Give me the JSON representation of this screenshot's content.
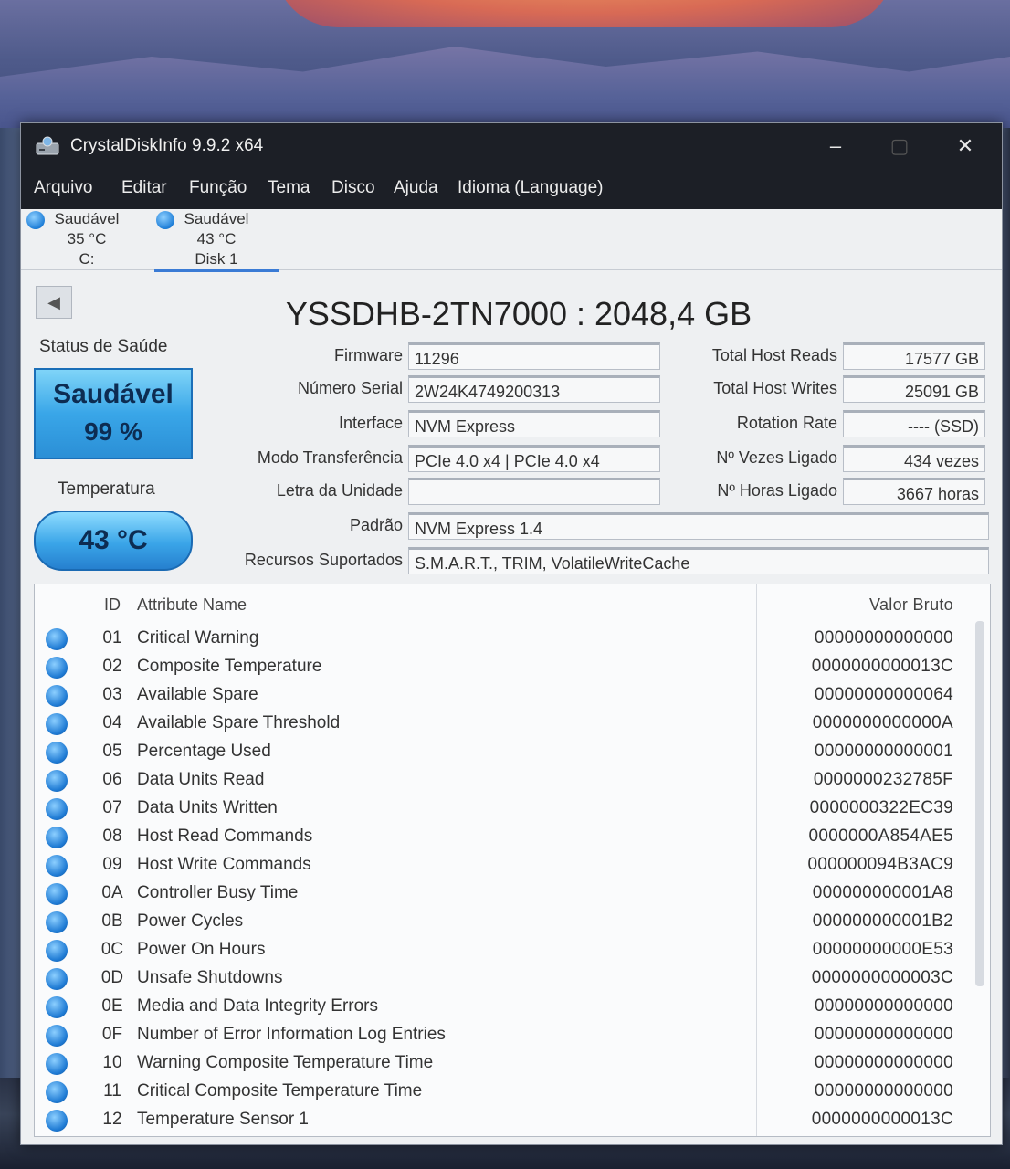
{
  "window": {
    "title": "CrystalDiskInfo 9.9.2 x64",
    "minimize_glyph": "–",
    "maximize_glyph": "▢",
    "close_glyph": "✕"
  },
  "menu": [
    "Arquivo",
    "Editar",
    "Função",
    "Tema",
    "Disco",
    "Ajuda",
    "Idioma (Language)"
  ],
  "drives": [
    {
      "status": "Saudável",
      "temp": "35 °C",
      "name": "C:"
    },
    {
      "status": "Saudável",
      "temp": "43 °C",
      "name": "Disk 1"
    }
  ],
  "health": {
    "label": "Status de Saúde",
    "status": "Saudável",
    "percent": "99 %",
    "temp_label": "Temperatura",
    "temp_value": "43 °C",
    "color": "#39a6e8"
  },
  "model": "YSSDHB-2TN7000 : 2048,4 GB",
  "info": {
    "firmware": {
      "label": "Firmware",
      "value": "11296"
    },
    "serial": {
      "label": "Número Serial",
      "value": "2W24K4749200313"
    },
    "interface": {
      "label": "Interface",
      "value": "NVM Express"
    },
    "transfer": {
      "label": "Modo Transferência",
      "value": "PCIe 4.0 x4 | PCIe 4.0 x4"
    },
    "drive_letter": {
      "label": "Letra da Unidade",
      "value": ""
    },
    "standard": {
      "label": "Padrão",
      "value": "NVM Express 1.4"
    },
    "features": {
      "label": "Recursos Suportados",
      "value": "S.M.A.R.T., TRIM, VolatileWriteCache"
    },
    "host_reads": {
      "label": "Total Host Reads",
      "value": "17577 GB"
    },
    "host_writes": {
      "label": "Total Host Writes",
      "value": "25091 GB"
    },
    "rotation": {
      "label": "Rotation Rate",
      "value": "---- (SSD)"
    },
    "power_count": {
      "label": "Nº Vezes Ligado",
      "value": "434 vezes"
    },
    "power_hours": {
      "label": "Nº Horas Ligado",
      "value": "3667 horas"
    }
  },
  "smart": {
    "headers": {
      "id": "ID",
      "name": "Attribute Name",
      "raw": "Valor Bruto"
    },
    "rows": [
      {
        "id": "01",
        "name": "Critical Warning",
        "raw": "00000000000000"
      },
      {
        "id": "02",
        "name": "Composite Temperature",
        "raw": "0000000000013C"
      },
      {
        "id": "03",
        "name": "Available Spare",
        "raw": "00000000000064"
      },
      {
        "id": "04",
        "name": "Available Spare Threshold",
        "raw": "0000000000000A"
      },
      {
        "id": "05",
        "name": "Percentage Used",
        "raw": "00000000000001"
      },
      {
        "id": "06",
        "name": "Data Units Read",
        "raw": "0000000232785F"
      },
      {
        "id": "07",
        "name": "Data Units Written",
        "raw": "0000000322EC39"
      },
      {
        "id": "08",
        "name": "Host Read Commands",
        "raw": "0000000A854AE5"
      },
      {
        "id": "09",
        "name": "Host Write Commands",
        "raw": "000000094B3AC9"
      },
      {
        "id": "0A",
        "name": "Controller Busy Time",
        "raw": "000000000001A8"
      },
      {
        "id": "0B",
        "name": "Power Cycles",
        "raw": "000000000001B2"
      },
      {
        "id": "0C",
        "name": "Power On Hours",
        "raw": "00000000000E53"
      },
      {
        "id": "0D",
        "name": "Unsafe Shutdowns",
        "raw": "0000000000003C"
      },
      {
        "id": "0E",
        "name": "Media and Data Integrity Errors",
        "raw": "00000000000000"
      },
      {
        "id": "0F",
        "name": "Number of Error Information Log Entries",
        "raw": "00000000000000"
      },
      {
        "id": "10",
        "name": "Warning Composite Temperature Time",
        "raw": "00000000000000"
      },
      {
        "id": "11",
        "name": "Critical Composite Temperature Time",
        "raw": "00000000000000"
      },
      {
        "id": "12",
        "name": "Temperature Sensor 1",
        "raw": "0000000000013C"
      }
    ]
  }
}
